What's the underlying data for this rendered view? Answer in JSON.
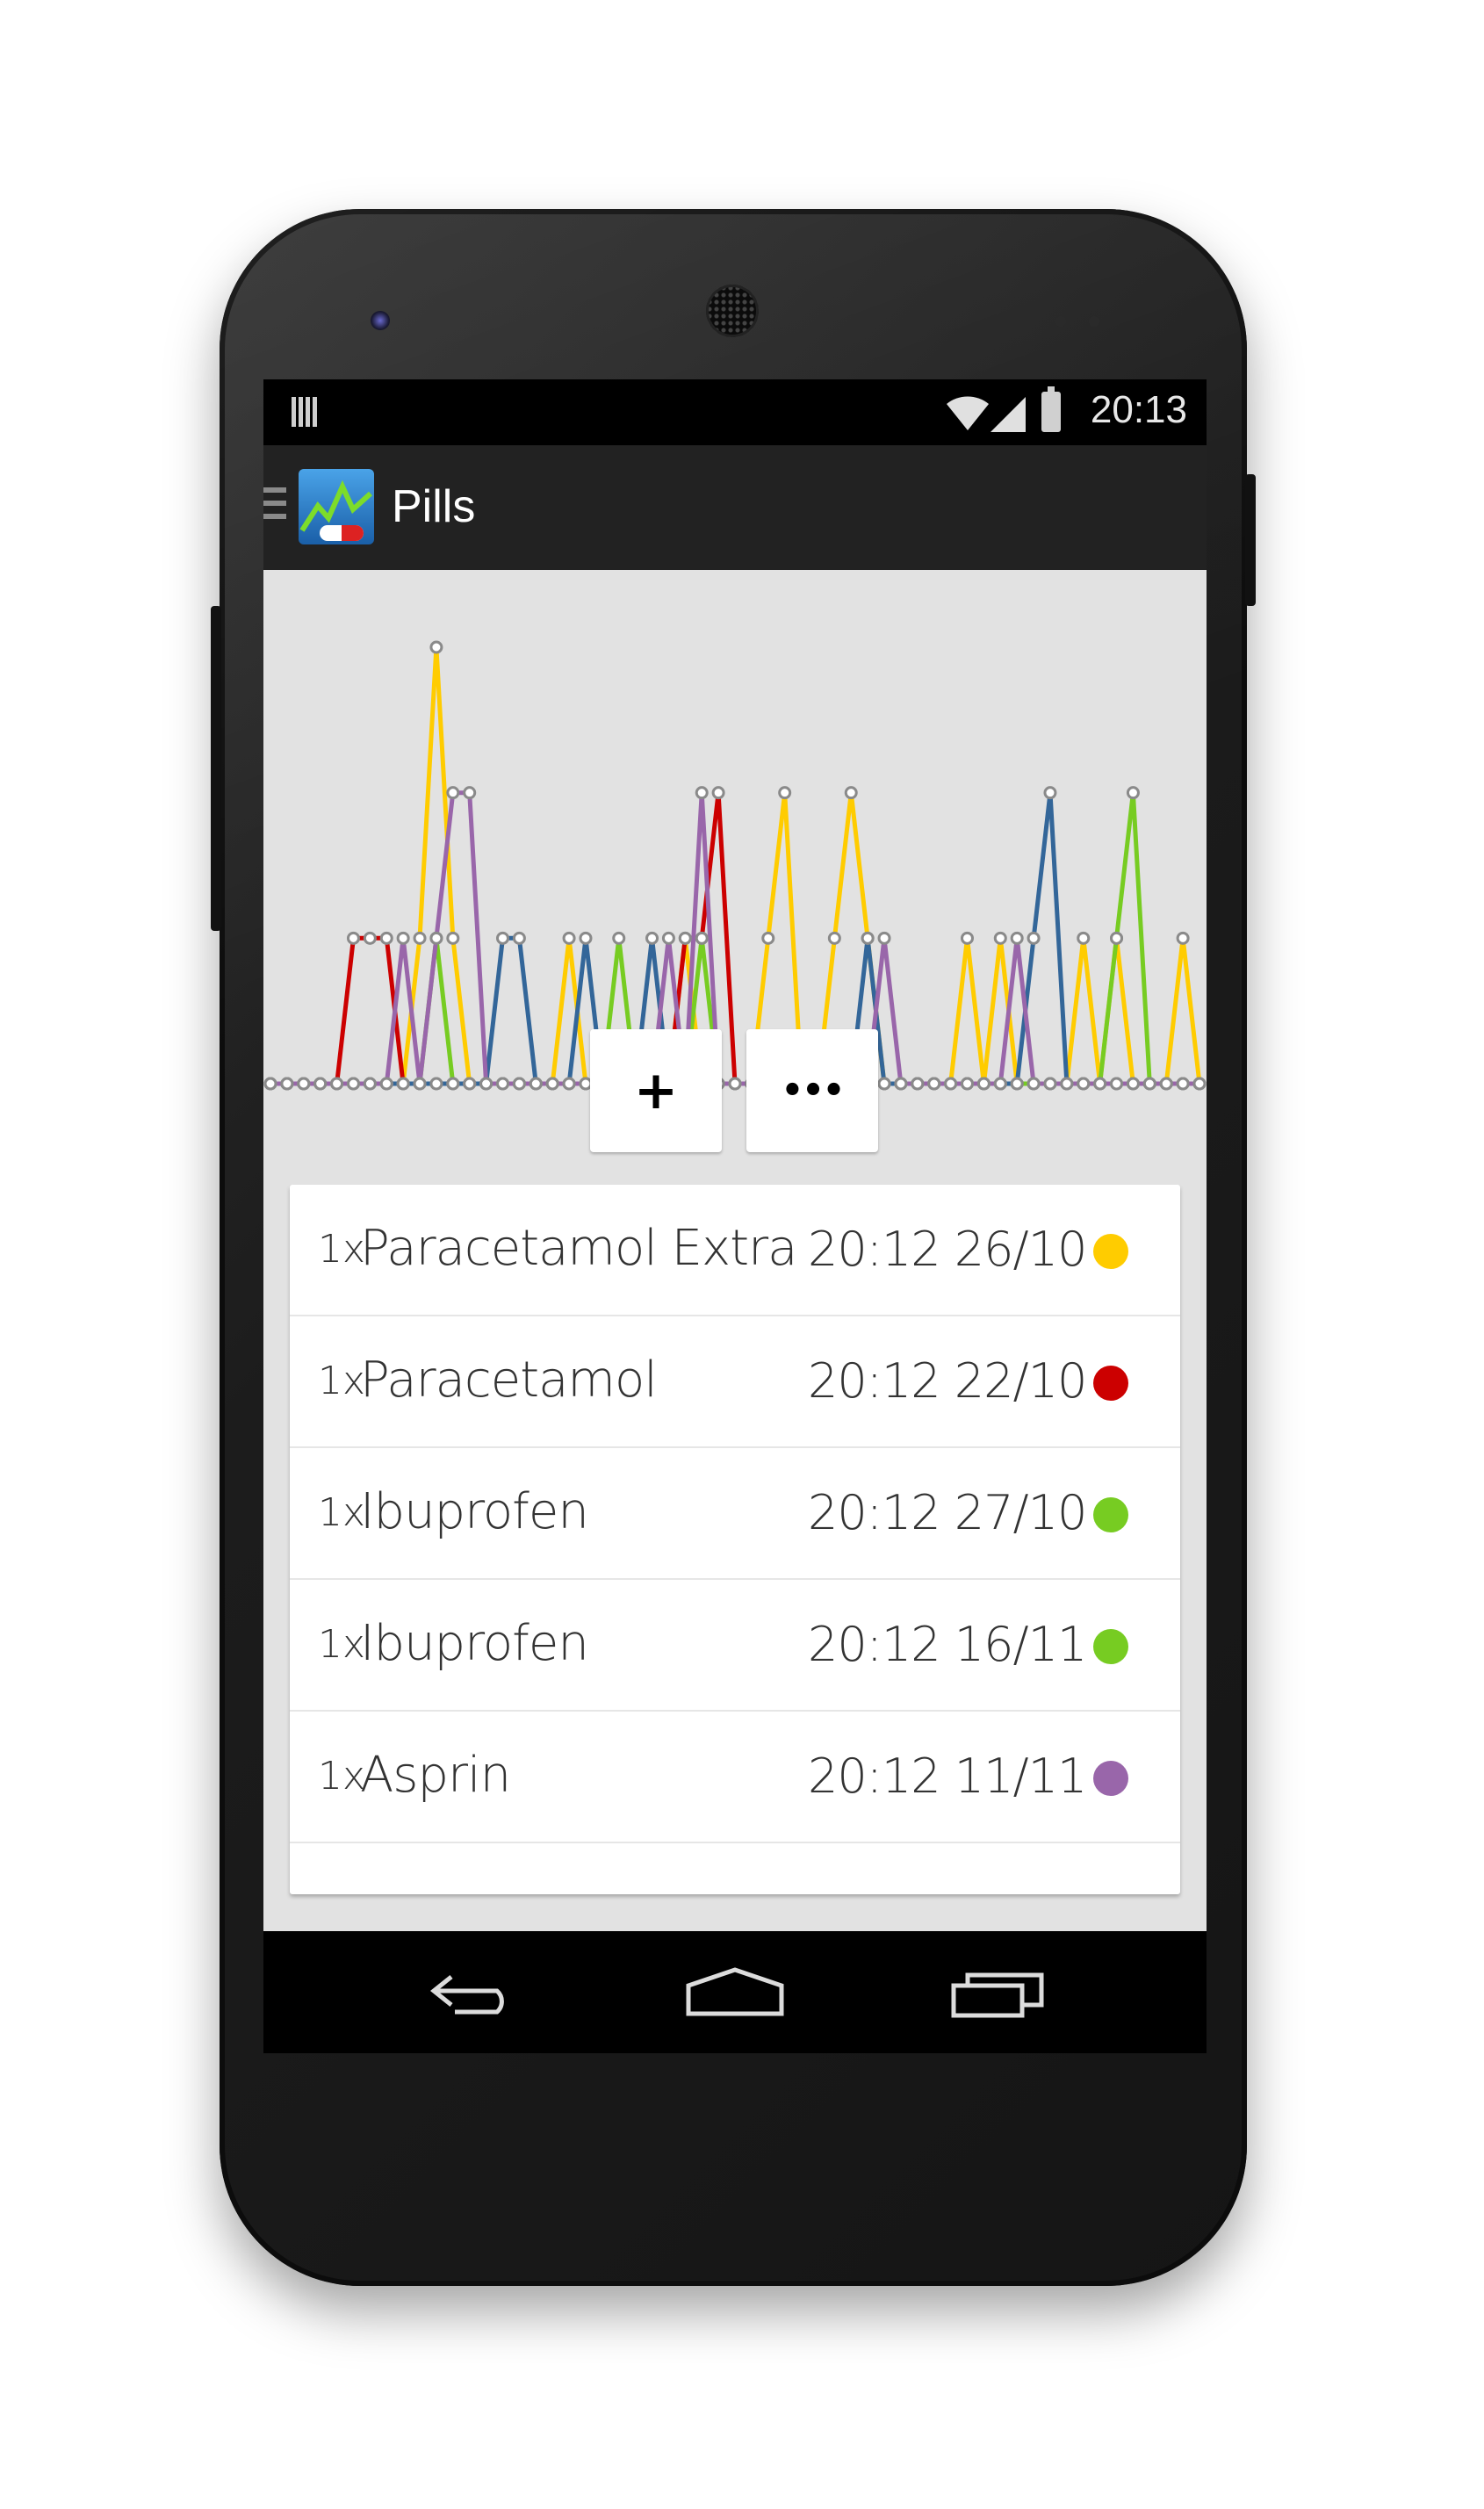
{
  "statusbar": {
    "time": "20:13",
    "icons": [
      "notification-icon",
      "wifi-icon",
      "signal-icon",
      "battery-charging-icon"
    ]
  },
  "actionbar": {
    "title": "Pills",
    "nav_icon": "drawer-menu-icon",
    "app_icon": "pills-chart-app-icon"
  },
  "controls": {
    "add_label": "+",
    "more_label": "•••"
  },
  "chart_data": {
    "type": "line",
    "series": [
      {
        "color": "#ffcc00",
        "values": [
          0,
          0,
          0,
          0,
          0,
          0,
          0,
          0,
          0,
          1,
          3,
          1,
          0,
          0,
          0,
          0,
          0,
          0,
          1,
          0,
          0,
          0,
          0,
          0,
          0,
          1,
          0,
          0,
          0,
          0,
          1,
          2,
          0,
          0,
          1,
          2,
          1,
          0,
          0,
          0,
          0,
          0,
          1,
          0,
          1,
          0,
          0,
          0,
          0,
          1,
          0,
          1,
          0,
          0,
          0,
          1,
          0
        ]
      },
      {
        "color": "#cc0000",
        "values": [
          0,
          0,
          0,
          0,
          0,
          1,
          1,
          1,
          0,
          0,
          0,
          0,
          0,
          0,
          0,
          0,
          0,
          0,
          0,
          0,
          0,
          0,
          0,
          0,
          0,
          1,
          1,
          2,
          0,
          0,
          0,
          0,
          0,
          0,
          0,
          0,
          0,
          0,
          0,
          0,
          0,
          0,
          0,
          0,
          0,
          0,
          0,
          0,
          0,
          0,
          0,
          0,
          0,
          0,
          0,
          0,
          0
        ]
      },
      {
        "color": "#77cc22",
        "values": [
          0,
          0,
          0,
          0,
          0,
          0,
          0,
          0,
          0,
          0,
          1,
          0,
          0,
          0,
          0,
          0,
          0,
          0,
          0,
          0,
          0,
          1,
          0,
          0,
          0,
          0,
          1,
          0,
          0,
          0,
          0,
          0,
          0,
          0,
          0,
          0,
          0,
          0,
          0,
          0,
          0,
          0,
          0,
          0,
          0,
          0,
          0,
          0,
          0,
          0,
          0,
          1,
          2,
          0,
          0,
          0,
          0
        ]
      },
      {
        "color": "#336699",
        "values": [
          0,
          0,
          0,
          0,
          0,
          0,
          0,
          0,
          0,
          0,
          0,
          0,
          0,
          0,
          1,
          1,
          0,
          0,
          0,
          1,
          0,
          0,
          0,
          1,
          0,
          0,
          0,
          0,
          0,
          0,
          0,
          0,
          0,
          0,
          0,
          0,
          1,
          0,
          0,
          0,
          0,
          0,
          0,
          0,
          0,
          0,
          1,
          2,
          0,
          0,
          0,
          0,
          0,
          0,
          0,
          0,
          0
        ]
      },
      {
        "color": "#9966aa",
        "values": [
          0,
          0,
          0,
          0,
          0,
          0,
          0,
          0,
          1,
          0,
          1,
          2,
          2,
          0,
          0,
          0,
          0,
          0,
          0,
          0,
          0,
          0,
          0,
          0,
          1,
          0,
          2,
          0,
          0,
          0,
          0,
          0,
          0,
          0,
          0,
          0,
          0,
          1,
          0,
          0,
          0,
          0,
          0,
          0,
          0,
          1,
          0,
          0,
          0,
          0,
          0,
          0,
          0,
          0,
          0,
          0,
          0
        ]
      }
    ],
    "ylim": [
      0,
      3
    ]
  },
  "list": {
    "items": [
      {
        "qty": "1x",
        "name": "Paracetamol Extra",
        "time": "20:12 26/10",
        "color": "#ffcc00"
      },
      {
        "qty": "1x",
        "name": "Paracetamol",
        "time": "20:12 22/10",
        "color": "#cc0000"
      },
      {
        "qty": "1x",
        "name": "Ibuprofen",
        "time": "20:12 27/10",
        "color": "#77cc22"
      },
      {
        "qty": "1x",
        "name": "Ibuprofen",
        "time": "20:12 16/11",
        "color": "#77cc22"
      },
      {
        "qty": "1x",
        "name": "Asprin",
        "time": "20:12 11/11",
        "color": "#9966aa"
      }
    ]
  },
  "navbar": {
    "icons": [
      "back-icon",
      "home-icon",
      "recent-apps-icon"
    ]
  }
}
